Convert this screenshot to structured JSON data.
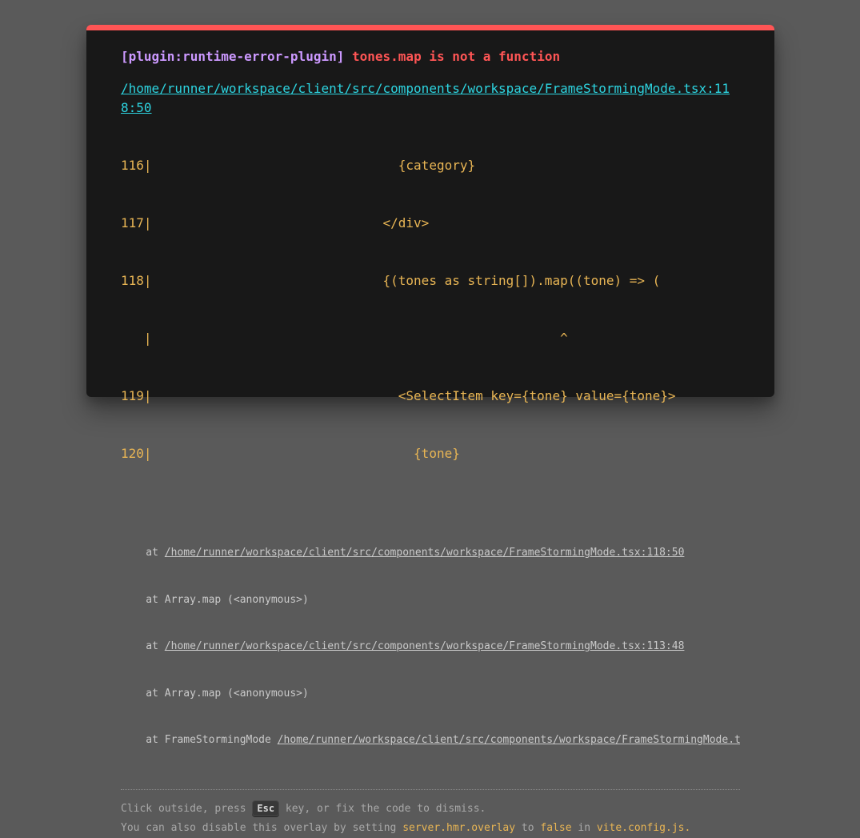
{
  "error": {
    "plugin": "[plugin:runtime-error-plugin]",
    "message": "tones.map is not a function",
    "file": "/home/runner/workspace/client/src/components/workspace/FrameStormingMode.tsx:118:50"
  },
  "frame": [
    "116|                                {category}",
    "117|                              </div>",
    "118|                              {(tones as string[]).map((tone) => (",
    "   |                                                     ^",
    "119|                                <SelectItem key={tone} value={tone}>",
    "120|                                  {tone}"
  ],
  "stack": [
    {
      "prefix": "    at ",
      "link": "/home/runner/workspace/client/src/components/workspace/FrameStormingMode.tsx:118:50",
      "suffix": ""
    },
    {
      "prefix": "    at Array.map (<anonymous>)",
      "link": "",
      "suffix": ""
    },
    {
      "prefix": "    at ",
      "link": "/home/runner/workspace/client/src/components/workspace/FrameStormingMode.tsx:113:48",
      "suffix": ""
    },
    {
      "prefix": "    at Array.map (<anonymous>)",
      "link": "",
      "suffix": ""
    },
    {
      "prefix": "    at FrameStormingMode ",
      "link": "/home/runner/workspace/client/src/components/workspace/FrameStormingMode.tsx",
      "suffix": ""
    }
  ],
  "tip": {
    "line1_before": "Click outside, press ",
    "esc_key": "Esc",
    "line1_after": " key, or fix the code to dismiss.",
    "line2_before": "You can also disable this overlay by setting ",
    "setting": "server.hmr.overlay",
    "to": " to ",
    "value": "false",
    "in": " in ",
    "config_file": "vite.config.js",
    "period": "."
  },
  "colors": {
    "accent_bar": "#ff5555",
    "plugin": "#cc99ff",
    "message": "#ff5555",
    "file_link": "#2dd4e0",
    "code": "#e8b554"
  }
}
